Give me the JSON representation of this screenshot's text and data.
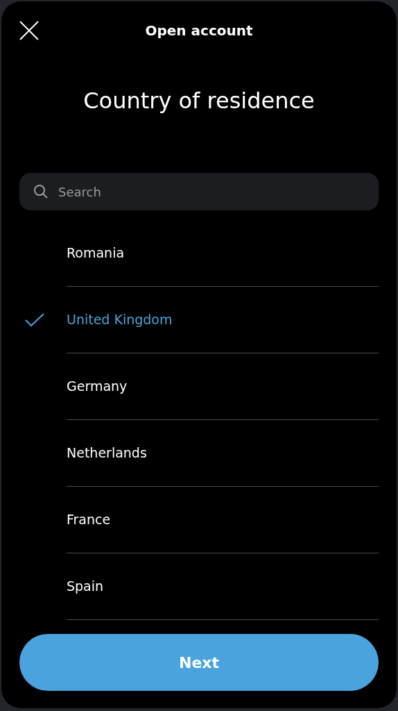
{
  "header": {
    "title": "Open account"
  },
  "heading": "Country of residence",
  "search": {
    "placeholder": "Search"
  },
  "countries": [
    {
      "name": "Romania",
      "selected": false
    },
    {
      "name": "United Kingdom",
      "selected": true
    },
    {
      "name": "Germany",
      "selected": false
    },
    {
      "name": "Netherlands",
      "selected": false
    },
    {
      "name": "France",
      "selected": false
    },
    {
      "name": "Spain",
      "selected": false
    }
  ],
  "button": "Next"
}
